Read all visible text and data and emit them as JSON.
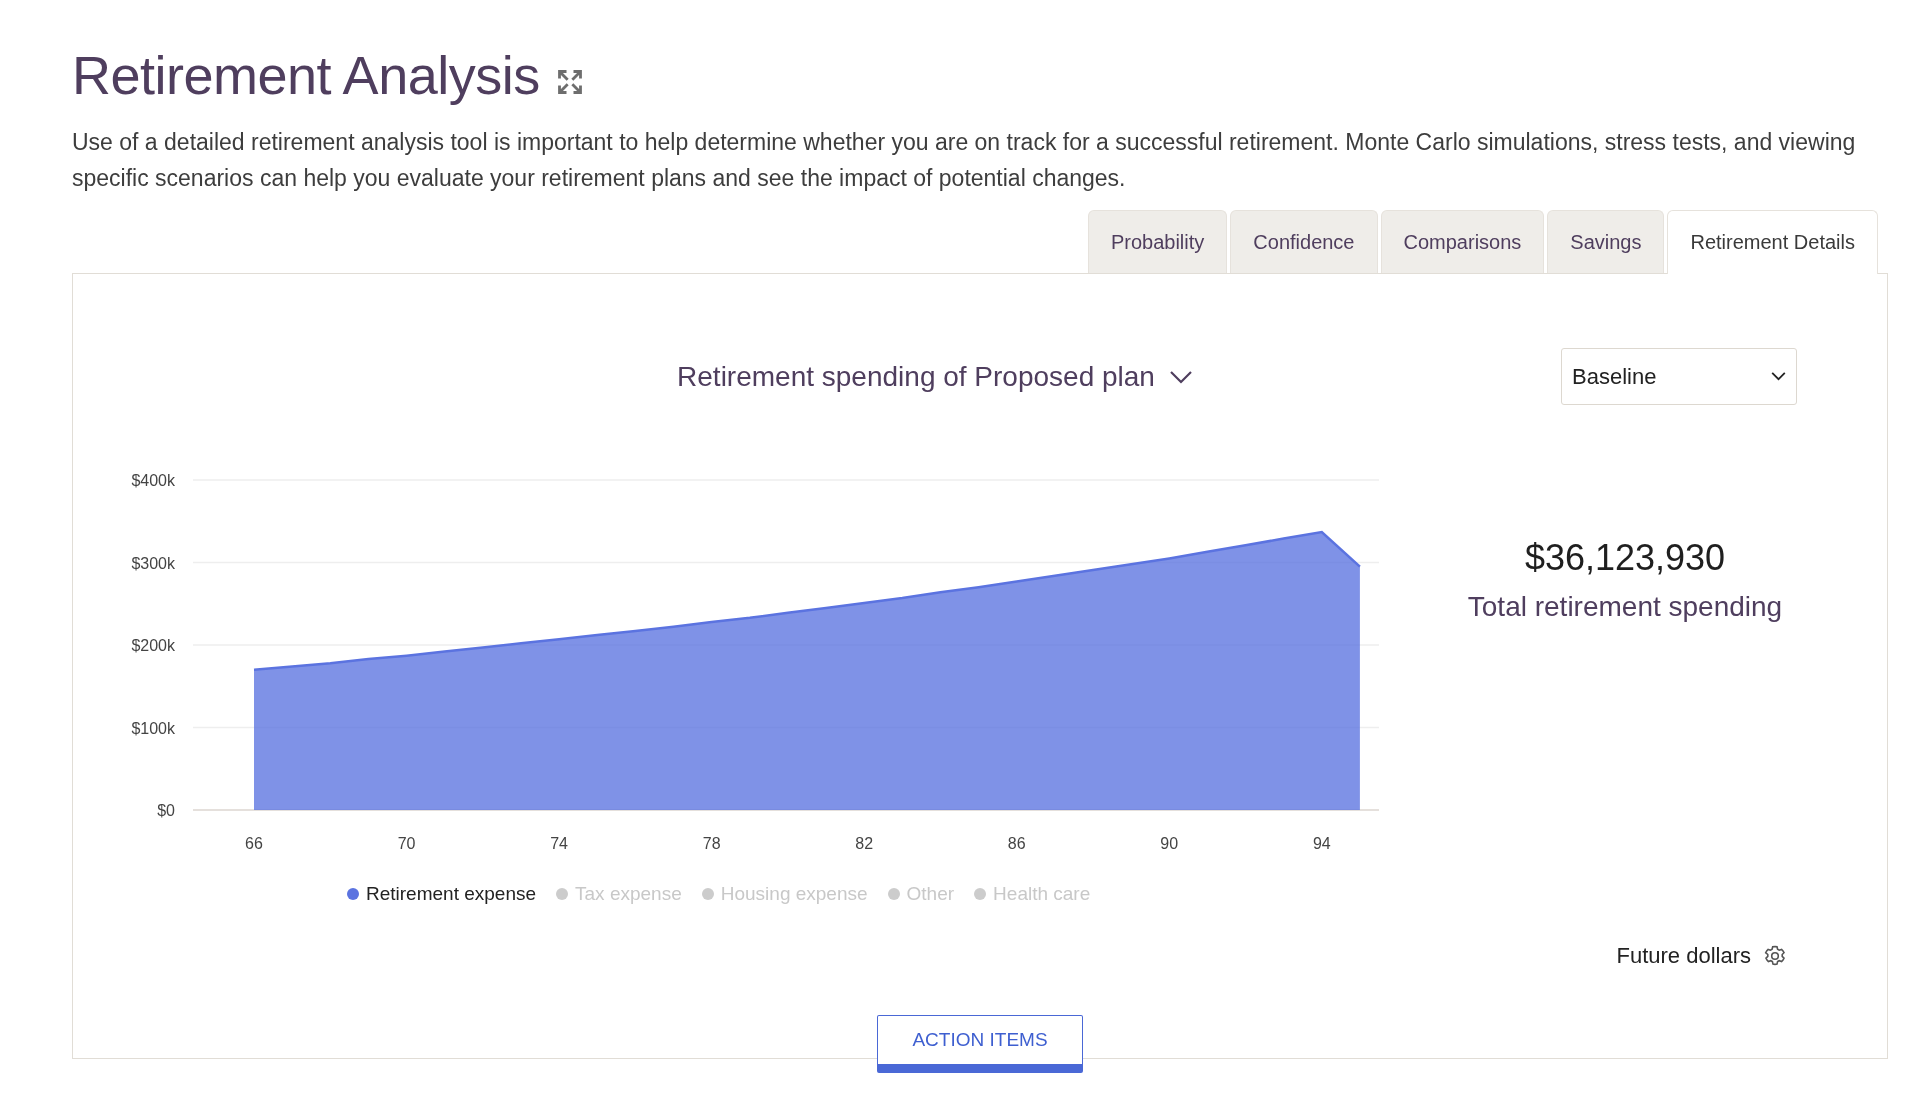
{
  "title": "Retirement Analysis",
  "description": "Use of a detailed retirement analysis tool is important to help determine whether you are on track for a successful retirement. Monte Carlo simulations, stress tests, and viewing specific scenarios can help you evaluate your retirement plans and see the impact of potential changes.",
  "tabs": [
    {
      "label": "Probability",
      "selected": false
    },
    {
      "label": "Confidence",
      "selected": false
    },
    {
      "label": "Comparisons",
      "selected": false
    },
    {
      "label": "Savings",
      "selected": false
    },
    {
      "label": "Retirement Details",
      "selected": true
    }
  ],
  "chart_heading": "Retirement spending of Proposed plan",
  "scenario_select": {
    "value": "Baseline"
  },
  "chart_data": {
    "type": "area",
    "x": [
      66,
      67,
      68,
      69,
      70,
      71,
      72,
      73,
      74,
      75,
      76,
      77,
      78,
      79,
      80,
      81,
      82,
      83,
      84,
      85,
      86,
      87,
      88,
      89,
      90,
      91,
      92,
      93,
      94,
      95
    ],
    "series": [
      {
        "name": "Retirement expense",
        "color": "#5b73e0",
        "values": [
          170,
          174,
          178,
          183,
          187,
          192,
          197,
          202,
          207,
          212,
          217,
          222,
          228,
          233,
          239,
          245,
          251,
          257,
          264,
          270,
          277,
          284,
          291,
          298,
          305,
          313,
          321,
          329,
          337,
          295
        ]
      }
    ],
    "xticks": [
      66,
      70,
      74,
      78,
      82,
      86,
      90,
      94
    ],
    "xlim": [
      64.4,
      95.5
    ],
    "grid": true,
    "ylim": [
      0,
      400
    ],
    "yticks": [
      {
        "value": 0,
        "label": "$0"
      },
      {
        "value": 100,
        "label": "$100k"
      },
      {
        "value": 200,
        "label": "$200k"
      },
      {
        "value": 300,
        "label": "$300k"
      },
      {
        "value": 400,
        "label": "$400k"
      }
    ]
  },
  "legend": [
    {
      "label": "Tax expense",
      "enabled": false
    },
    {
      "label": "Housing expense",
      "enabled": false
    },
    {
      "label": "Other",
      "enabled": false
    },
    {
      "label": "Health care",
      "enabled": false
    }
  ],
  "total": {
    "value": "$36,123,930",
    "label": "Total retirement spending"
  },
  "dollars_mode": "Future dollars",
  "action_button": "ACTION ITEMS"
}
